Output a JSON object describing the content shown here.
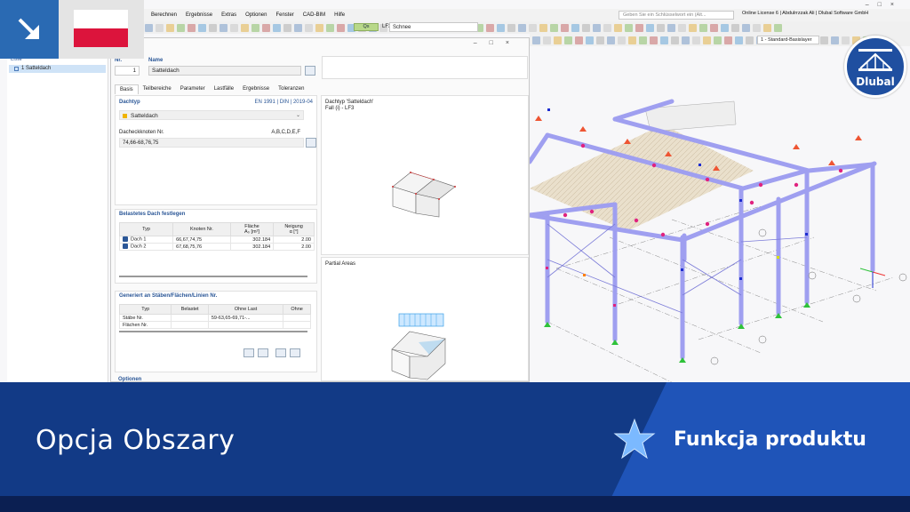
{
  "menu": [
    "Berechnen",
    "Ergebnisse",
    "Extras",
    "Optionen",
    "Fenster",
    "CAD-BIM",
    "Hilfe"
  ],
  "search": {
    "placeholder": "Geben Sie ein Schlüsselwort ein (Alt..."
  },
  "license": "Online License 6 | Abdulrrzzak Ali | Dlubal Software GmbH",
  "loadcase": {
    "code": "Qs",
    "id": "LF3",
    "name": "Schnee"
  },
  "layer": "1 - Standard-Basislayer",
  "navigator": {
    "title": "Liste",
    "item": "1  Satteldach"
  },
  "dialog": {
    "no_label": "Nr.",
    "no_value": "1",
    "name_label": "Name",
    "name_value": "Satteldach",
    "tabs": [
      "Basis",
      "Teilbereiche",
      "Parameter",
      "Lastfälle",
      "Ergebnisse",
      "Toleranzen"
    ],
    "dachtyp": {
      "header": "Dachtyp",
      "norm": "EN 1991 | DIN | 2019-04",
      "selected": "Satteldach",
      "nodes_label": "Dacheckknoten Nr.",
      "nodes_hint": "A,B,C,D,E,F",
      "nodes_value": "74,66-68,76,75"
    },
    "belastet": {
      "header": "Belastetes Dach festlegen",
      "columns": [
        "Typ",
        "Knoten Nr.",
        "Fläche A₀ [m²]",
        "Neigung α [°]"
      ],
      "col_flaeche": "Fläche",
      "col_flaeche_sub": "A₀ [m²]",
      "col_neigung": "Neigung",
      "col_neigung_sub": "α [°]",
      "rows": [
        {
          "typ": "Dach 1",
          "nodes": "66,67,74,75",
          "area": "302.184",
          "slope": "2.00"
        },
        {
          "typ": "Dach 2",
          "nodes": "67,68,75,76",
          "area": "302.184",
          "slope": "2.00"
        }
      ]
    },
    "generiert": {
      "header": "Generiert an Stäben/Flächen/Linien Nr.",
      "columns": [
        "Typ",
        "Belastet",
        "Ohne Last",
        "Ohne"
      ],
      "rows": [
        {
          "typ": "Stäbe Nr.",
          "belastet": "",
          "ohne": "59-63,65-69,71-..."
        },
        {
          "typ": "Flächen Nr.",
          "belastet": "",
          "ohne": ""
        }
      ]
    },
    "optionen": "Optionen",
    "preview1": {
      "title": "Dachtyp 'Satteldach'",
      "subtitle": "Fall (i) - LF3"
    },
    "preview2": {
      "title": "Partial Areas"
    }
  },
  "banner": {
    "title": "Opcja Obszary",
    "function": "Funkcja produktu"
  },
  "logo": "Dlubal",
  "colors": {
    "banner": "#123a86",
    "banner_accent": "#1f54b8",
    "brand": "#2a6ab3",
    "frame": "#9f9ff0"
  }
}
